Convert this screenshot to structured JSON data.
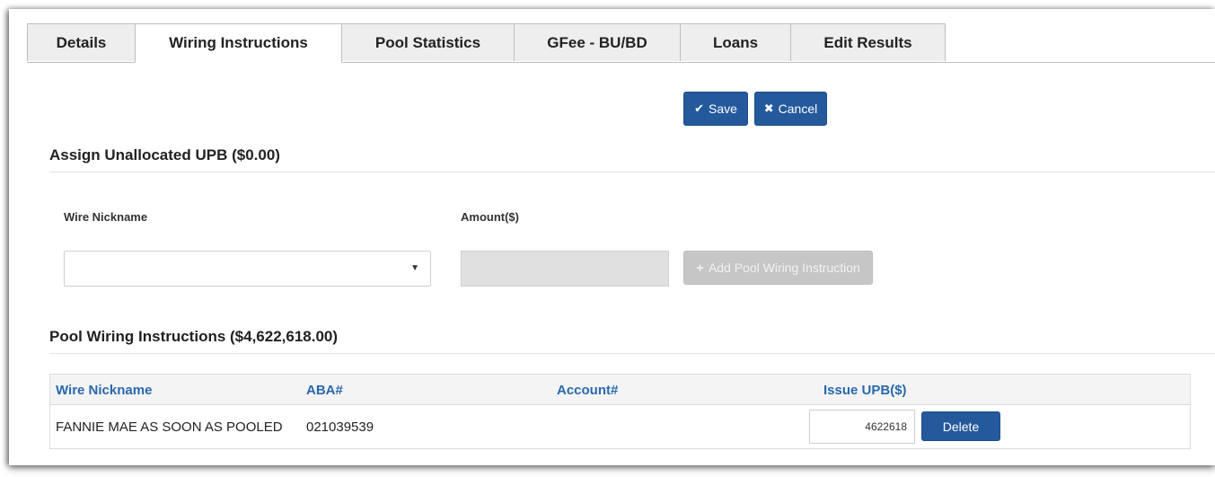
{
  "tabs": [
    {
      "label": "Details"
    },
    {
      "label": "Wiring Instructions"
    },
    {
      "label": "Pool Statistics"
    },
    {
      "label": "GFee - BU/BD"
    },
    {
      "label": "Loans"
    },
    {
      "label": "Edit Results"
    }
  ],
  "active_tab": "Wiring Instructions",
  "toolbar": {
    "save_label": "Save",
    "cancel_label": "Cancel"
  },
  "assign": {
    "title": "Assign Unallocated UPB ($0.00)",
    "wire_nickname_label": "Wire Nickname",
    "amount_label": "Amount($)",
    "wire_nickname_value": "",
    "amount_value": "",
    "add_button_label": "Add Pool Wiring Instruction"
  },
  "pool": {
    "title": "Pool Wiring Instructions ($4,622,618.00)",
    "columns": [
      "Wire Nickname",
      "ABA#",
      "Account#",
      "Issue UPB($)"
    ],
    "rows": [
      {
        "wire_nickname": "FANNIE MAE AS SOON AS POOLED",
        "aba": "021039539",
        "account": "",
        "issue_upb": "4622618",
        "delete_label": "Delete"
      }
    ]
  },
  "colors": {
    "primary": "#245a9c",
    "link": "#2a68ad",
    "disabled": "#c6c6c6"
  },
  "icons": {
    "save": "check-icon",
    "cancel": "x-icon",
    "add": "plus-icon",
    "select": "caret-down-icon"
  }
}
